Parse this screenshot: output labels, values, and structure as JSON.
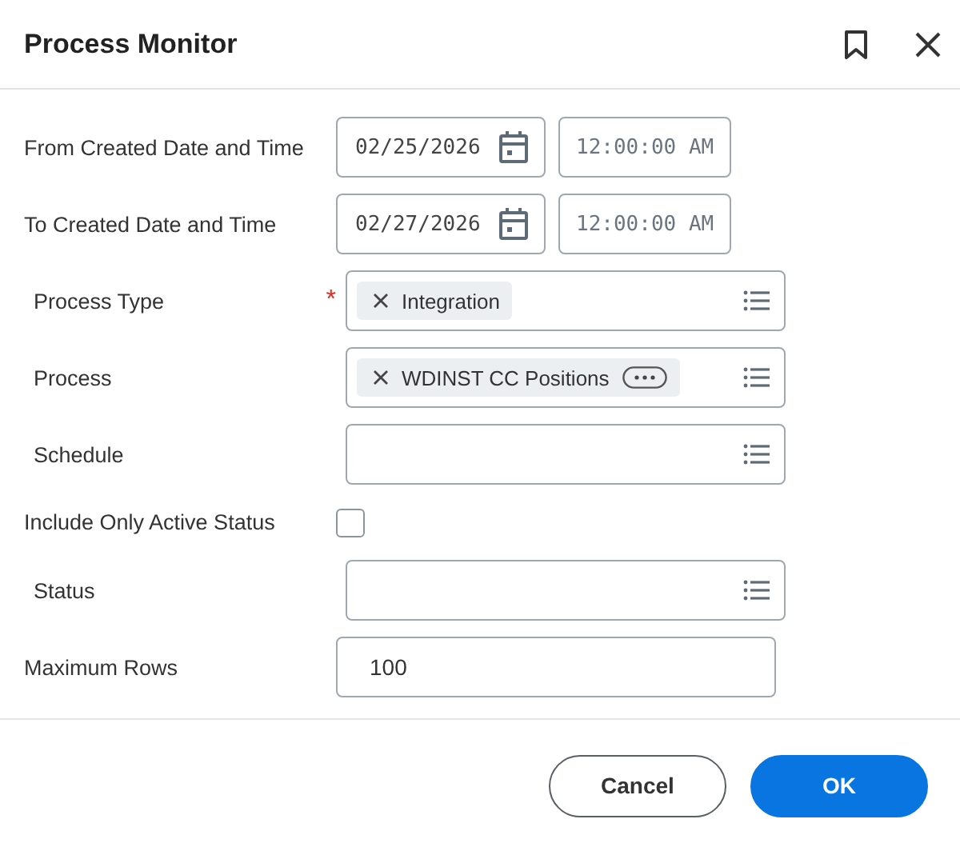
{
  "dialog": {
    "title": "Process Monitor"
  },
  "fields": [
    {
      "kind": "datetime",
      "label": "From Created Date and Time",
      "date": "02/25/2026",
      "time": "12:00:00 AM"
    },
    {
      "kind": "datetime",
      "label": "To Created Date and Time",
      "date": "02/27/2026",
      "time": "12:00:00 AM"
    },
    {
      "kind": "prompt",
      "label": "Process Type",
      "required_mark": "*",
      "chips": [
        {
          "text": "Integration",
          "more": false
        }
      ]
    },
    {
      "kind": "prompt",
      "label": "Process",
      "chips": [
        {
          "text": "WDINST CC Positions",
          "more": true
        }
      ]
    },
    {
      "kind": "prompt",
      "label": "Schedule"
    },
    {
      "kind": "checkbox",
      "label": "Include Only Active Status",
      "checked": false
    },
    {
      "kind": "prompt",
      "label": "Status"
    },
    {
      "kind": "text",
      "label": "Maximum Rows",
      "value": "100"
    }
  ],
  "buttons": [
    {
      "label": "Cancel",
      "primary": false
    },
    {
      "label": "OK",
      "primary": true
    }
  ]
}
